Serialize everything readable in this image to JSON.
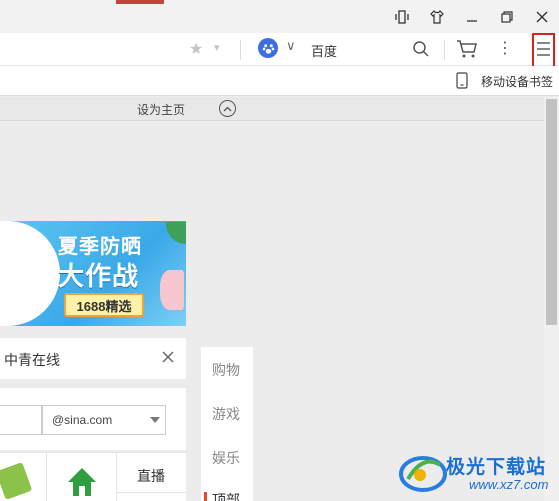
{
  "titlebar": {
    "buttons": [
      {
        "name": "compact-mode-icon",
        "glyph": "▯"
      },
      {
        "name": "skin-icon",
        "glyph": "👕"
      },
      {
        "name": "minimize-icon",
        "glyph": "—"
      },
      {
        "name": "restore-icon",
        "glyph": "❐"
      },
      {
        "name": "close-icon",
        "glyph": "✕"
      }
    ]
  },
  "addressbar": {
    "star_glyph": "★",
    "caret_glyph": "▾",
    "search_engine": "百度",
    "engine_caret": "∨",
    "more_glyph": "⋮"
  },
  "bookmarkbar": {
    "mobile_label": "移动设备书签"
  },
  "homebar": {
    "set_home_label": "设为主页"
  },
  "banner": {
    "subtitle": "夏季防晒",
    "title": "大作战",
    "badge": "1688精选"
  },
  "notice": {
    "text": "中青在线"
  },
  "mail": {
    "domain": "@sina.com"
  },
  "apps": {
    "live_label": "直播"
  },
  "sidenav": {
    "items": [
      "购物",
      "游戏",
      "娱乐",
      "顶部"
    ]
  },
  "watermark": {
    "name": "极光下载站",
    "url": "www.xz7.com"
  },
  "colors": {
    "highlight_border": "#e02020",
    "engine_blue": "#3a6fe0",
    "watermark_blue": "#1b6fd0"
  }
}
